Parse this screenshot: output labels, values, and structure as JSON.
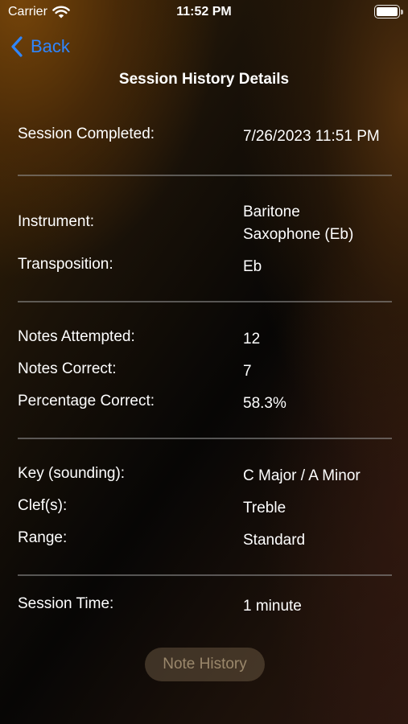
{
  "status_bar": {
    "carrier": "Carrier",
    "time": "11:52 PM"
  },
  "nav": {
    "back_label": "Back",
    "title": "Session History Details"
  },
  "details": {
    "session_completed": {
      "label": "Session Completed:",
      "value": "7/26/2023 11:51 PM"
    },
    "instrument": {
      "label": "Instrument:",
      "value_line1": "Baritone",
      "value_line2": "Saxophone (Eb)"
    },
    "transposition": {
      "label": "Transposition:",
      "value": "Eb"
    },
    "notes_attempted": {
      "label": "Notes Attempted:",
      "value": "12"
    },
    "notes_correct": {
      "label": "Notes Correct:",
      "value": "7"
    },
    "percentage_correct": {
      "label": "Percentage Correct:",
      "value": "58.3%"
    },
    "key": {
      "label": "Key (sounding):",
      "value": "C Major / A Minor"
    },
    "clefs": {
      "label": "Clef(s):",
      "value": "Treble"
    },
    "range": {
      "label": "Range:",
      "value": "Standard"
    },
    "session_time": {
      "label": "Session Time:",
      "value": "1 minute"
    }
  },
  "note_history_button": {
    "label": "Note History",
    "enabled": false
  },
  "colors": {
    "accent": "#2f86ff",
    "text": "#ffffff",
    "divider": "#8c8c8c"
  },
  "icons": [
    "wifi-icon",
    "battery-icon",
    "chevron-left-icon"
  ]
}
